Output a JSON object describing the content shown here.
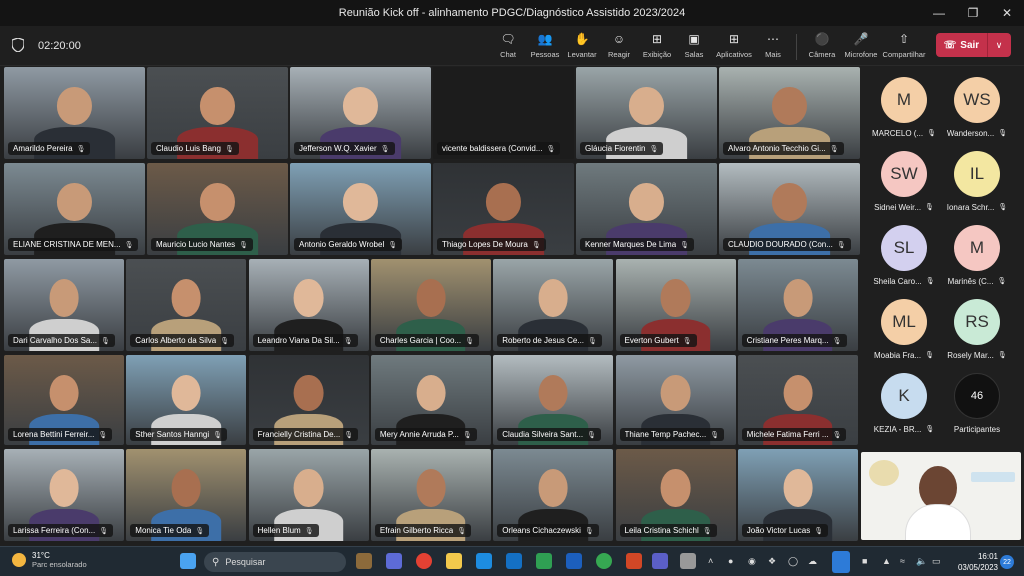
{
  "window": {
    "title": "Reunião Kick off - alinhamento PDGC/Diagnóstico Assistido 2023/2024"
  },
  "meeting": {
    "timer": "02:20:00"
  },
  "toolbar": {
    "buttons": [
      {
        "label": "Chat",
        "icon": "chat-icon"
      },
      {
        "label": "Pessoas",
        "icon": "people-icon"
      },
      {
        "label": "Levantar",
        "icon": "raise-hand-icon"
      },
      {
        "label": "Reagir",
        "icon": "react-icon"
      },
      {
        "label": "Exibição",
        "icon": "view-icon"
      },
      {
        "label": "Salas",
        "icon": "rooms-icon"
      },
      {
        "label": "Aplicativos",
        "icon": "apps-icon"
      },
      {
        "label": "Mais",
        "icon": "more-icon"
      },
      {
        "label": "Câmera",
        "icon": "camera-icon"
      },
      {
        "label": "Microfone",
        "icon": "microphone-icon"
      },
      {
        "label": "Compartilhar",
        "icon": "share-icon"
      }
    ],
    "leave_label": "Sair"
  },
  "participants": [
    "Amarildo Pereira",
    "Claudio Luis Bang",
    "Jefferson W.Q. Xavier",
    "vicente baldissera (Convid...",
    "Gláucia Fiorentin",
    "Alvaro Antonio Tecchio Gi...",
    "ELIANE CRISTINA DE MEN...",
    "Mauricio Lucio Nantes",
    "Antonio Geraldo Wrobel",
    "Thiago Lopes De Moura",
    "Kenner Marques De Lima",
    "CLAUDIO DOURADO (Con...",
    "Dari Carvalho Dos Sa...",
    "Carlos Alberto da Silva",
    "Leandro Viana Da Sil...",
    "Charles Garcia | Coo...",
    "Roberto de Jesus Ce...",
    "Everton Gubert",
    "Cristiane Peres Marq...",
    "Lorena Bettini Ferreir...",
    "Sther Santos Hanngi",
    "Francielly Cristina De...",
    "Mery Annie Arruda P...",
    "Claudia Silveira Sant...",
    "Thiane Temp Pachec...",
    "Michele Fatima Ferri ...",
    "Larissa Ferreira (Con...",
    "Monica Tie Oda",
    "Hellen Blum",
    "Efrain Gilberto Ricca",
    "Orleans Cichaczewski",
    "Leila Cristina Schichl",
    "João Victor Lucas"
  ],
  "sidebar_avatars": [
    {
      "initials": "M",
      "name": "MARCELO (...",
      "color": "#f4cfa7"
    },
    {
      "initials": "WS",
      "name": "Wanderson...",
      "color": "#f4cfa7"
    },
    {
      "initials": "SW",
      "name": "Sidnei Weir...",
      "color": "#f5c7c2"
    },
    {
      "initials": "IL",
      "name": "Ionara Schr...",
      "color": "#f3e7a1"
    },
    {
      "initials": "SL",
      "name": "Sheila Caro...",
      "color": "#d3d0ef"
    },
    {
      "initials": "M",
      "name": "Marinês (C...",
      "color": "#f5c7c2"
    },
    {
      "initials": "ML",
      "name": "Moabia Fra...",
      "color": "#f4cfa7"
    },
    {
      "initials": "RS",
      "name": "Rosely Mar...",
      "color": "#c9ead6"
    },
    {
      "initials": "K",
      "name": "KEZIA - BR...",
      "color": "#c7dcef"
    },
    {
      "initials": "46",
      "name": "Participantes",
      "color": "#111111"
    }
  ],
  "taskbar": {
    "weather_temp": "31°C",
    "weather_desc": "Parc ensolarado",
    "search_placeholder": "Pesquisar",
    "time": "16:01",
    "date": "03/05/2023",
    "notifications": "22"
  }
}
